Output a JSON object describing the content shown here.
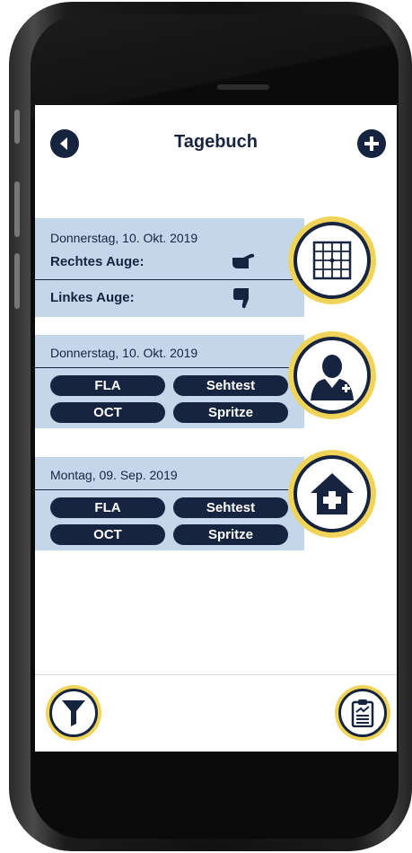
{
  "header": {
    "title": "Tagebuch"
  },
  "entries": [
    {
      "date": "Donnerstag, 10. Okt. 2019",
      "right_eye_label": "Rechtes Auge:",
      "right_eye_rating": "thumb-up-icon",
      "left_eye_label": "Linkes Auge:",
      "left_eye_rating": "thumb-down-icon",
      "circle_icon": "amsler-grid-icon"
    },
    {
      "date": "Donnerstag, 10. Okt. 2019",
      "tags": [
        "FLA",
        "Sehtest",
        "OCT",
        "Spritze"
      ],
      "circle_icon": "doctor-icon"
    },
    {
      "date": "Montag, 09. Sep. 2019",
      "tags": [
        "FLA",
        "Sehtest",
        "OCT",
        "Spritze"
      ],
      "circle_icon": "home-medical-icon"
    }
  ],
  "footer": {
    "left_icon": "filter-funnel-icon",
    "right_icon": "clipboard-chart-icon"
  },
  "colors": {
    "navy": "#17243f",
    "row_blue": "#c4d7ea",
    "gold": "#f0d45a"
  }
}
